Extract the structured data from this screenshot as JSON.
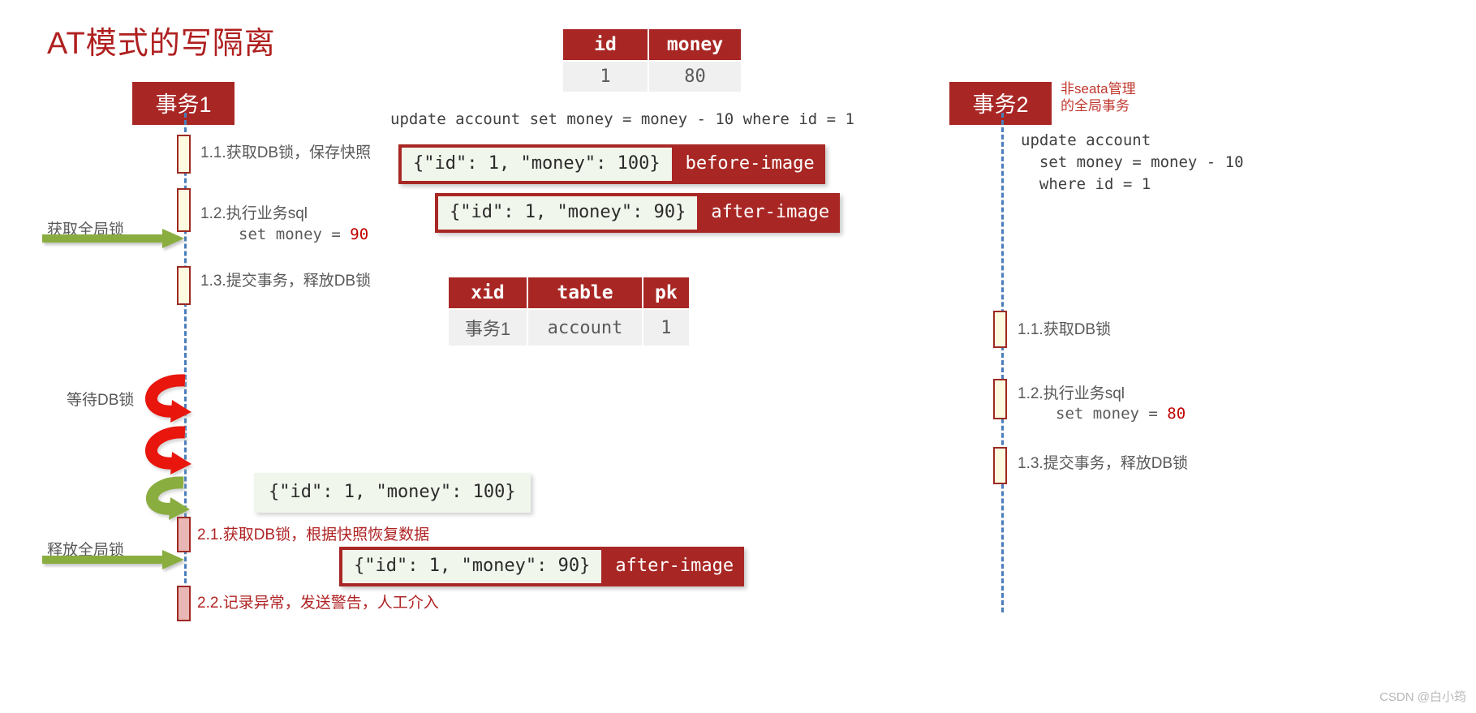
{
  "title": "AT模式的写隔离",
  "colors": {
    "brand_red": "#a82724",
    "title_red": "#b02020",
    "lifeline_blue": "#4a7ebb",
    "activation_fill": "#fcfbe0",
    "rollback_fill": "#e8b6b4",
    "green_arrow": "#8aad41",
    "red_arrow": "#e8120c",
    "step_text": "#595959",
    "table_cell_bg": "#f0f0f0",
    "json_box_bg": "#f1f6ec"
  },
  "account_table": {
    "type": "table",
    "name": "account",
    "headers": [
      "id",
      "money"
    ],
    "rows": [
      [
        "1",
        "80"
      ]
    ]
  },
  "lock_table": {
    "type": "table",
    "name": "lock_table",
    "headers": [
      "xid",
      "table",
      "pk"
    ],
    "rows": [
      [
        "事务1",
        "account",
        "1"
      ]
    ]
  },
  "txn1": {
    "chip_label": "事务1",
    "sql": "update account set money = money - 10 where id = 1",
    "steps": [
      {
        "label": "1.1.获取DB锁，保存快照"
      },
      {
        "label": "1.2.执行业务sql",
        "detail": "set money = ",
        "detail_value": "90"
      },
      {
        "label": "1.3.提交事务，释放DB锁"
      },
      {
        "label": "2.1.获取DB锁，根据快照恢复数据"
      },
      {
        "label": "2.2.记录异常，发送警告，人工介入"
      }
    ],
    "global_lock_acquire": "获取全局锁",
    "global_lock_release": "释放全局锁",
    "wait_db_lock": "等待DB锁",
    "before_image": {
      "json": "{\"id\": 1, \"money\": 100}",
      "tag": "before-image"
    },
    "after_image": {
      "json": "{\"id\": 1, \"money\": 90}",
      "tag": "after-image"
    },
    "rollback_snapshot": "{\"id\": 1, \"money\": 100}",
    "rollback_after_image": {
      "json": "{\"id\": 1, \"money\": 90}",
      "tag": "after-image"
    }
  },
  "txn2": {
    "chip_label": "事务2",
    "note": "非seata管理\n的全局事务",
    "sql": "update account\n  set money = money - 10\n  where id = 1",
    "steps": [
      {
        "label": "1.1.获取DB锁"
      },
      {
        "label": "1.2.执行业务sql",
        "detail": "set money = ",
        "detail_value": "80"
      },
      {
        "label": "1.3.提交事务，释放DB锁"
      }
    ]
  },
  "watermark": "CSDN @白小筠"
}
